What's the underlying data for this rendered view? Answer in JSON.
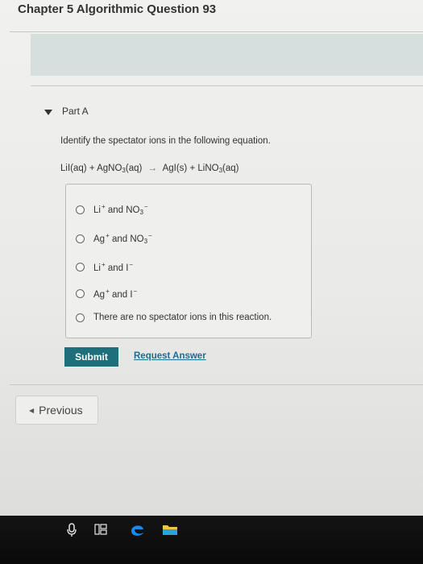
{
  "page": {
    "title": "Chapter 5 Algorithmic Question 93"
  },
  "part": {
    "label": "Part A"
  },
  "question": {
    "prompt": "Identify the spectator ions in the following equation.",
    "equation": {
      "lhs1": "LiI(aq)",
      "plus1": "+",
      "lhs2_pre": "AgNO",
      "lhs2_sub": "3",
      "lhs2_post": "(aq)",
      "arrow": "→",
      "rhs1": "AgI(s)",
      "plus2": "+",
      "rhs2_pre": "LiNO",
      "rhs2_sub": "3",
      "rhs2_post": "(aq)"
    }
  },
  "options": [
    {
      "a": "Li",
      "a_sup": "+",
      "and": "and",
      "b": "NO",
      "b_sub": "3",
      "b_sup": "−"
    },
    {
      "a": "Ag",
      "a_sup": "+",
      "and": "and",
      "b": "NO",
      "b_sub": "3",
      "b_sup": "−"
    },
    {
      "a": "Li",
      "a_sup": "+",
      "and": "and",
      "b": "I",
      "b_sup": "−"
    },
    {
      "a": "Ag",
      "a_sup": "+",
      "and": "and",
      "b": "I",
      "b_sup": "−"
    },
    {
      "text": "There are no spectator ions in this reaction."
    }
  ],
  "actions": {
    "submit_label": "Submit",
    "request_label": "Request Answer",
    "previous_label": "Previous"
  },
  "colors": {
    "submit_bg": "#1d6f7c",
    "link": "#1e6c8e",
    "banner": "#d7dede",
    "taskbar": "#111111"
  },
  "taskbar": {
    "icons": [
      "microphone-icon",
      "task-view-icon",
      "edge-browser-icon",
      "file-explorer-icon"
    ]
  }
}
